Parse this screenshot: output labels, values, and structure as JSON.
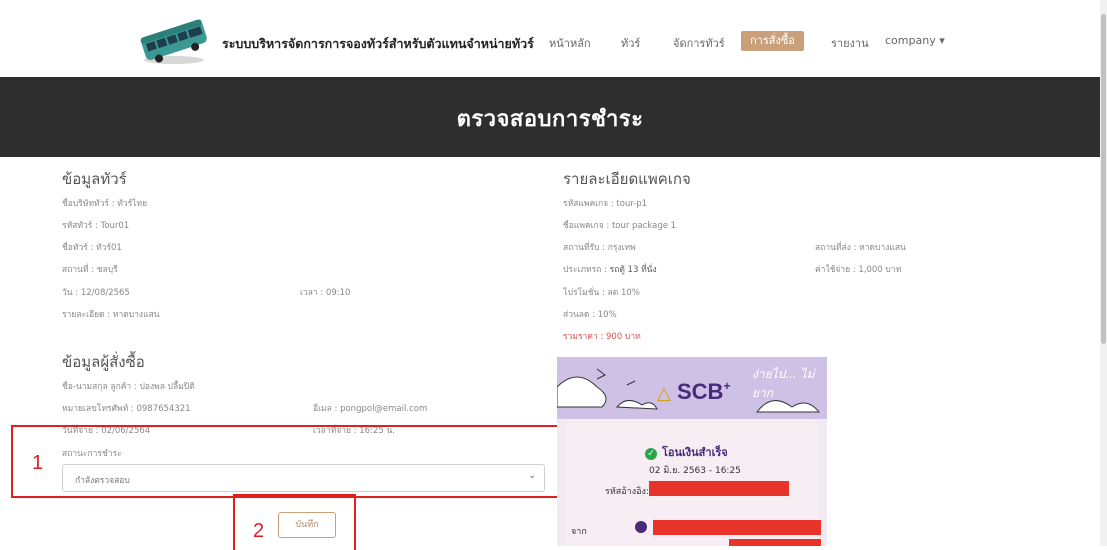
{
  "nav": {
    "brand": "ระบบบริหารจัดการการจองทัวร์สำหรับตัวแทนจำหน่ายทัวร์",
    "items": [
      "หน้าหลัก",
      "ทัวร์",
      "จัดการทัวร์",
      "การสั่งซื้อ",
      "รายงาน",
      "company ▾"
    ]
  },
  "hero": {
    "title": "ตรวจสอบการชำระ"
  },
  "tour": {
    "heading": "ข้อมูลทัวร์",
    "company": "ชื่อบริษัททัวร์ : ทัวร์ไทย",
    "code": "รหัสทัวร์ : Tour01",
    "name": "ชื่อทัวร์ : ทัวร์01",
    "place": "สถานที่ : ชลบุรี",
    "date": "วัน : 12/08/2565",
    "time": "เวลา : 09:10",
    "detail": "รายละเอียด : หาดบางแสน"
  },
  "package": {
    "heading": "รายละเอียดแพคเกจ",
    "code": "รหัสแพคเกจ : tour-p1",
    "name": "ชื่อแพคเกจ : tour package 1",
    "pickup": "สถานที่รับ : กรุงเทพ",
    "dropoff": "สถานที่ส่ง : หาดบางแสน",
    "type_label": "ประเภทรถ : ",
    "type_value": "รถตู้ 13 ที่นั่ง",
    "cost": "ค่าใช้จ่าย : 1,000 บาท",
    "promo": "โปรโมชั่น : ลด 10%",
    "discount": "ส่วนลด : 10%",
    "total": "รวมราคา : 900 บาท"
  },
  "buyer": {
    "heading": "ข้อมูลผู้สั่งซื้อ",
    "name": "ชื่อ-นามสกุล ลูกค้า : ปองพล ปลื้มปิติ",
    "phone": "หมายเลขโทรศัพท์ : 0987654321",
    "email": "อีเมล : pongpol@email.com",
    "paydate": "วันที่จ่าย : 02/06/2564",
    "paytime": "เวลาที่จ่าย : 16:25 น.",
    "status_label": "สถานะการชำระ",
    "status_value": "กำลังตรวจสอบ"
  },
  "save_label": "บันทึก",
  "annotations": {
    "one": "1",
    "two": "2"
  },
  "slip": {
    "brand": "SCB",
    "plus": "+",
    "slogan": "ง่ายไป... ไม่ยาก",
    "success": "โอนเงินสำเร็จ",
    "datetime": "02 มิ.ย. 2563 - 16:25",
    "ref_label": "รหัสอ้างอิง:",
    "from_label": "จาก"
  },
  "colors": {
    "accent": "#c9a07a",
    "hero_bg": "#2e2e2e",
    "annotation": "#e02020",
    "total": "#e05050"
  }
}
